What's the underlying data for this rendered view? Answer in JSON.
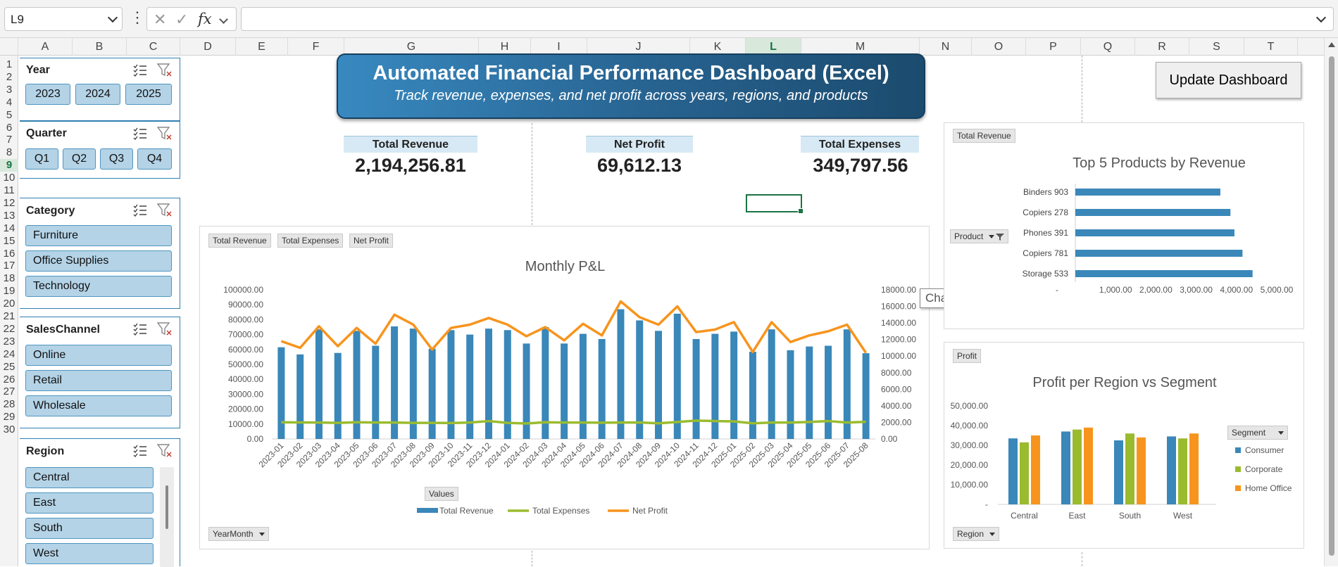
{
  "formula_bar": {
    "name_box": "L9",
    "formula": "",
    "fx": "fx",
    "cancel": "✕",
    "enter": "✓"
  },
  "columns": [
    "A",
    "B",
    "C",
    "D",
    "E",
    "F",
    "G",
    "H",
    "I",
    "J",
    "K",
    "L",
    "M",
    "N",
    "O",
    "P",
    "Q",
    "R",
    "S",
    "T"
  ],
  "selected_column": "L",
  "rows": [
    "1",
    "2",
    "3",
    "4",
    "5",
    "6",
    "7",
    "8",
    "9",
    "10",
    "11",
    "12",
    "13",
    "14",
    "15",
    "16",
    "17",
    "18",
    "19",
    "20",
    "21",
    "22",
    "23",
    "24",
    "25",
    "26",
    "27",
    "28",
    "29",
    "30"
  ],
  "selected_row": "9",
  "slicers": {
    "year": {
      "title": "Year",
      "items": [
        "2023",
        "2024",
        "2025"
      ]
    },
    "quarter": {
      "title": "Quarter",
      "items": [
        "Q1",
        "Q2",
        "Q3",
        "Q4"
      ]
    },
    "category": {
      "title": "Category",
      "items": [
        "Furniture",
        "Office Supplies",
        "Technology"
      ]
    },
    "sales_channel": {
      "title": "SalesChannel",
      "items": [
        "Online",
        "Retail",
        "Wholesale"
      ]
    },
    "region": {
      "title": "Region",
      "items": [
        "Central",
        "East",
        "South",
        "West"
      ]
    }
  },
  "banner": {
    "title": "Automated Financial Performance Dashboard (Excel)",
    "subtitle": "Track revenue, expenses, and net profit across years, regions, and products"
  },
  "kpis": {
    "revenue": {
      "label": "Total Revenue",
      "value": "2,194,256.81"
    },
    "profit": {
      "label": "Net Profit",
      "value": "69,612.13"
    },
    "expenses": {
      "label": "Total Expenses",
      "value": "349,797.56"
    }
  },
  "update_button": "Update Dashboard",
  "tooltip": "Chart Area",
  "monthly_chart": {
    "title": "Monthly P&L",
    "field_buttons": [
      "Total Revenue",
      "Total Expenses",
      "Net Profit"
    ],
    "values_button": "Values",
    "axis_button": "YearMonth",
    "legend": [
      "Total Revenue",
      "Total Expenses",
      "Net Profit"
    ],
    "left_ticks": [
      "100000.00",
      "90000.00",
      "80000.00",
      "70000.00",
      "60000.00",
      "50000.00",
      "40000.00",
      "30000.00",
      "20000.00",
      "10000.00",
      "0.00"
    ],
    "right_ticks": [
      "18000.00",
      "16000.00",
      "14000.00",
      "12000.00",
      "10000.00",
      "8000.00",
      "6000.00",
      "4000.00",
      "2000.00",
      "0.00"
    ],
    "colors": {
      "revenue": "#3a87b9",
      "expenses": "#9bbb2f",
      "profit": "#f7941d"
    }
  },
  "top5_chart": {
    "title": "Top 5 Products by Revenue",
    "field_button": "Total Revenue",
    "axis_button": "Product",
    "x_ticks": [
      "-",
      "1,000.00",
      "2,000.00",
      "3,000.00",
      "4,000.00",
      "5,000.00"
    ],
    "color": "#3a87b9"
  },
  "region_chart": {
    "title": "Profit per Region vs Segment",
    "field_button": "Profit",
    "axis_button": "Region",
    "legend_button": "Segment",
    "y_ticks": [
      "50,000.00",
      "40,000.00",
      "30,000.00",
      "20,000.00",
      "10,000.00",
      "-"
    ],
    "colors": {
      "Consumer": "#3a87b9",
      "Corporate": "#9bbb2f",
      "Home Office": "#f7941d"
    }
  },
  "chart_data": [
    {
      "type": "bar",
      "title": "Monthly P&L",
      "categories": [
        "2023-01",
        "2023-02",
        "2023-03",
        "2023-04",
        "2023-05",
        "2023-06",
        "2023-07",
        "2023-08",
        "2023-09",
        "2023-10",
        "2023-11",
        "2023-12",
        "2024-01",
        "2024-02",
        "2024-03",
        "2024-04",
        "2024-05",
        "2024-06",
        "2024-07",
        "2024-08",
        "2024-09",
        "2024-10",
        "2024-11",
        "2024-12",
        "2025-01",
        "2025-02",
        "2025-03",
        "2025-04",
        "2025-05",
        "2025-06",
        "2025-07",
        "2025-08"
      ],
      "series": [
        {
          "name": "Total Revenue",
          "axis": "left",
          "render": "bar",
          "values": [
            61500,
            56700,
            73500,
            57700,
            72500,
            62500,
            75500,
            74000,
            60500,
            73000,
            70000,
            74000,
            73000,
            64000,
            75000,
            64000,
            70500,
            67000,
            87000,
            79500,
            72500,
            84000,
            67000,
            70500,
            72000,
            58500,
            73500,
            59500,
            62000,
            62500,
            73500,
            57500
          ]
        },
        {
          "name": "Total Expenses",
          "axis": "left",
          "render": "line",
          "values": [
            11200,
            11100,
            11000,
            10800,
            11200,
            11000,
            11000,
            10800,
            10800,
            10700,
            11000,
            12000,
            10800,
            10400,
            11200,
            11000,
            11000,
            10900,
            11000,
            11100,
            10500,
            11400,
            12300,
            12000,
            11800,
            10500,
            11000,
            11000,
            11400,
            12000,
            11000,
            11500
          ]
        },
        {
          "name": "Net Profit",
          "axis": "right",
          "render": "line",
          "values": [
            11800,
            11000,
            13600,
            11200,
            13400,
            11500,
            15000,
            13800,
            10800,
            13400,
            13800,
            14600,
            13800,
            12400,
            13500,
            11900,
            13900,
            12500,
            16600,
            14700,
            13800,
            16000,
            12900,
            13200,
            14100,
            10500,
            14100,
            11700,
            12500,
            13000,
            13800,
            10400
          ]
        }
      ],
      "ylim": [
        0,
        100000
      ],
      "y2lim": [
        0,
        18000
      ],
      "legend": "bottom"
    },
    {
      "type": "bar",
      "orientation": "horizontal",
      "title": "Top 5 Products by Revenue",
      "categories": [
        "Binders 903",
        "Copiers 278",
        "Phones 391",
        "Copiers 781",
        "Storage 533"
      ],
      "values": [
        3600,
        3850,
        3950,
        4150,
        4400
      ],
      "xlim": [
        0,
        5000
      ]
    },
    {
      "type": "bar",
      "title": "Profit per Region vs Segment",
      "categories": [
        "Central",
        "East",
        "South",
        "West"
      ],
      "series": [
        {
          "name": "Consumer",
          "values": [
            33500,
            37000,
            32500,
            34500
          ]
        },
        {
          "name": "Corporate",
          "values": [
            31500,
            38000,
            36000,
            33500
          ]
        },
        {
          "name": "Home Office",
          "values": [
            35000,
            39000,
            34000,
            36000
          ]
        }
      ],
      "ylim": [
        0,
        50000
      ],
      "legend": "right"
    }
  ]
}
